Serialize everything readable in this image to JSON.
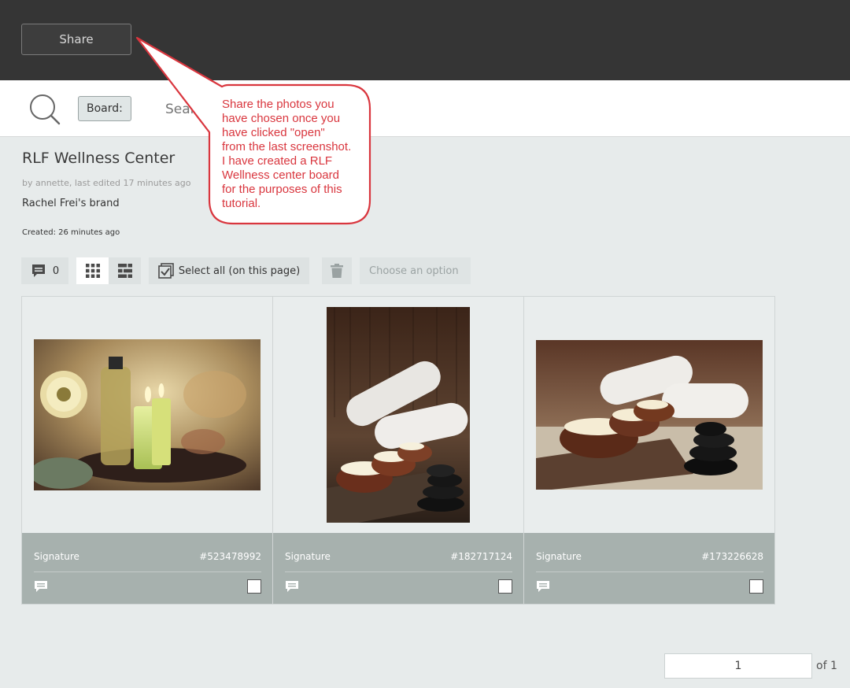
{
  "header": {
    "share_label": "Share"
  },
  "search": {
    "board_chip": "Board:",
    "placeholder": "Search"
  },
  "board": {
    "title": "RLF Wellness Center",
    "meta": "by annette, last edited 17 minutes ago",
    "description": "Rachel Frei's brand",
    "created": "Created: 26 minutes ago"
  },
  "toolbar": {
    "comment_count": "0",
    "select_all": "Select all (on this page)",
    "option_placeholder": "Choose an option"
  },
  "cards": [
    {
      "name": "Signature",
      "id": "#523478992",
      "checked": false
    },
    {
      "name": "Signature",
      "id": "#182717124",
      "checked": false
    },
    {
      "name": "Signature",
      "id": "#173226628",
      "checked": false
    }
  ],
  "pagination": {
    "current": "1",
    "total_label": "of 1"
  },
  "callout": {
    "lines": [
      "Share the photos you",
      "have chosen once you",
      "have clicked \"open\"",
      "from the last screenshot.",
      "I have created a RLF",
      "Wellness center board",
      "for the purposes of this",
      "tutorial."
    ]
  },
  "colors": {
    "topbar": "#353535",
    "page_bg": "#e7ebeb",
    "card_footer": "#a7b1ae",
    "callout_red": "#d9363e"
  },
  "icons": [
    "search-icon",
    "comment-icon",
    "grid-view-icon",
    "list-view-icon",
    "select-all-icon",
    "trash-icon",
    "comment-bubble-icon"
  ]
}
